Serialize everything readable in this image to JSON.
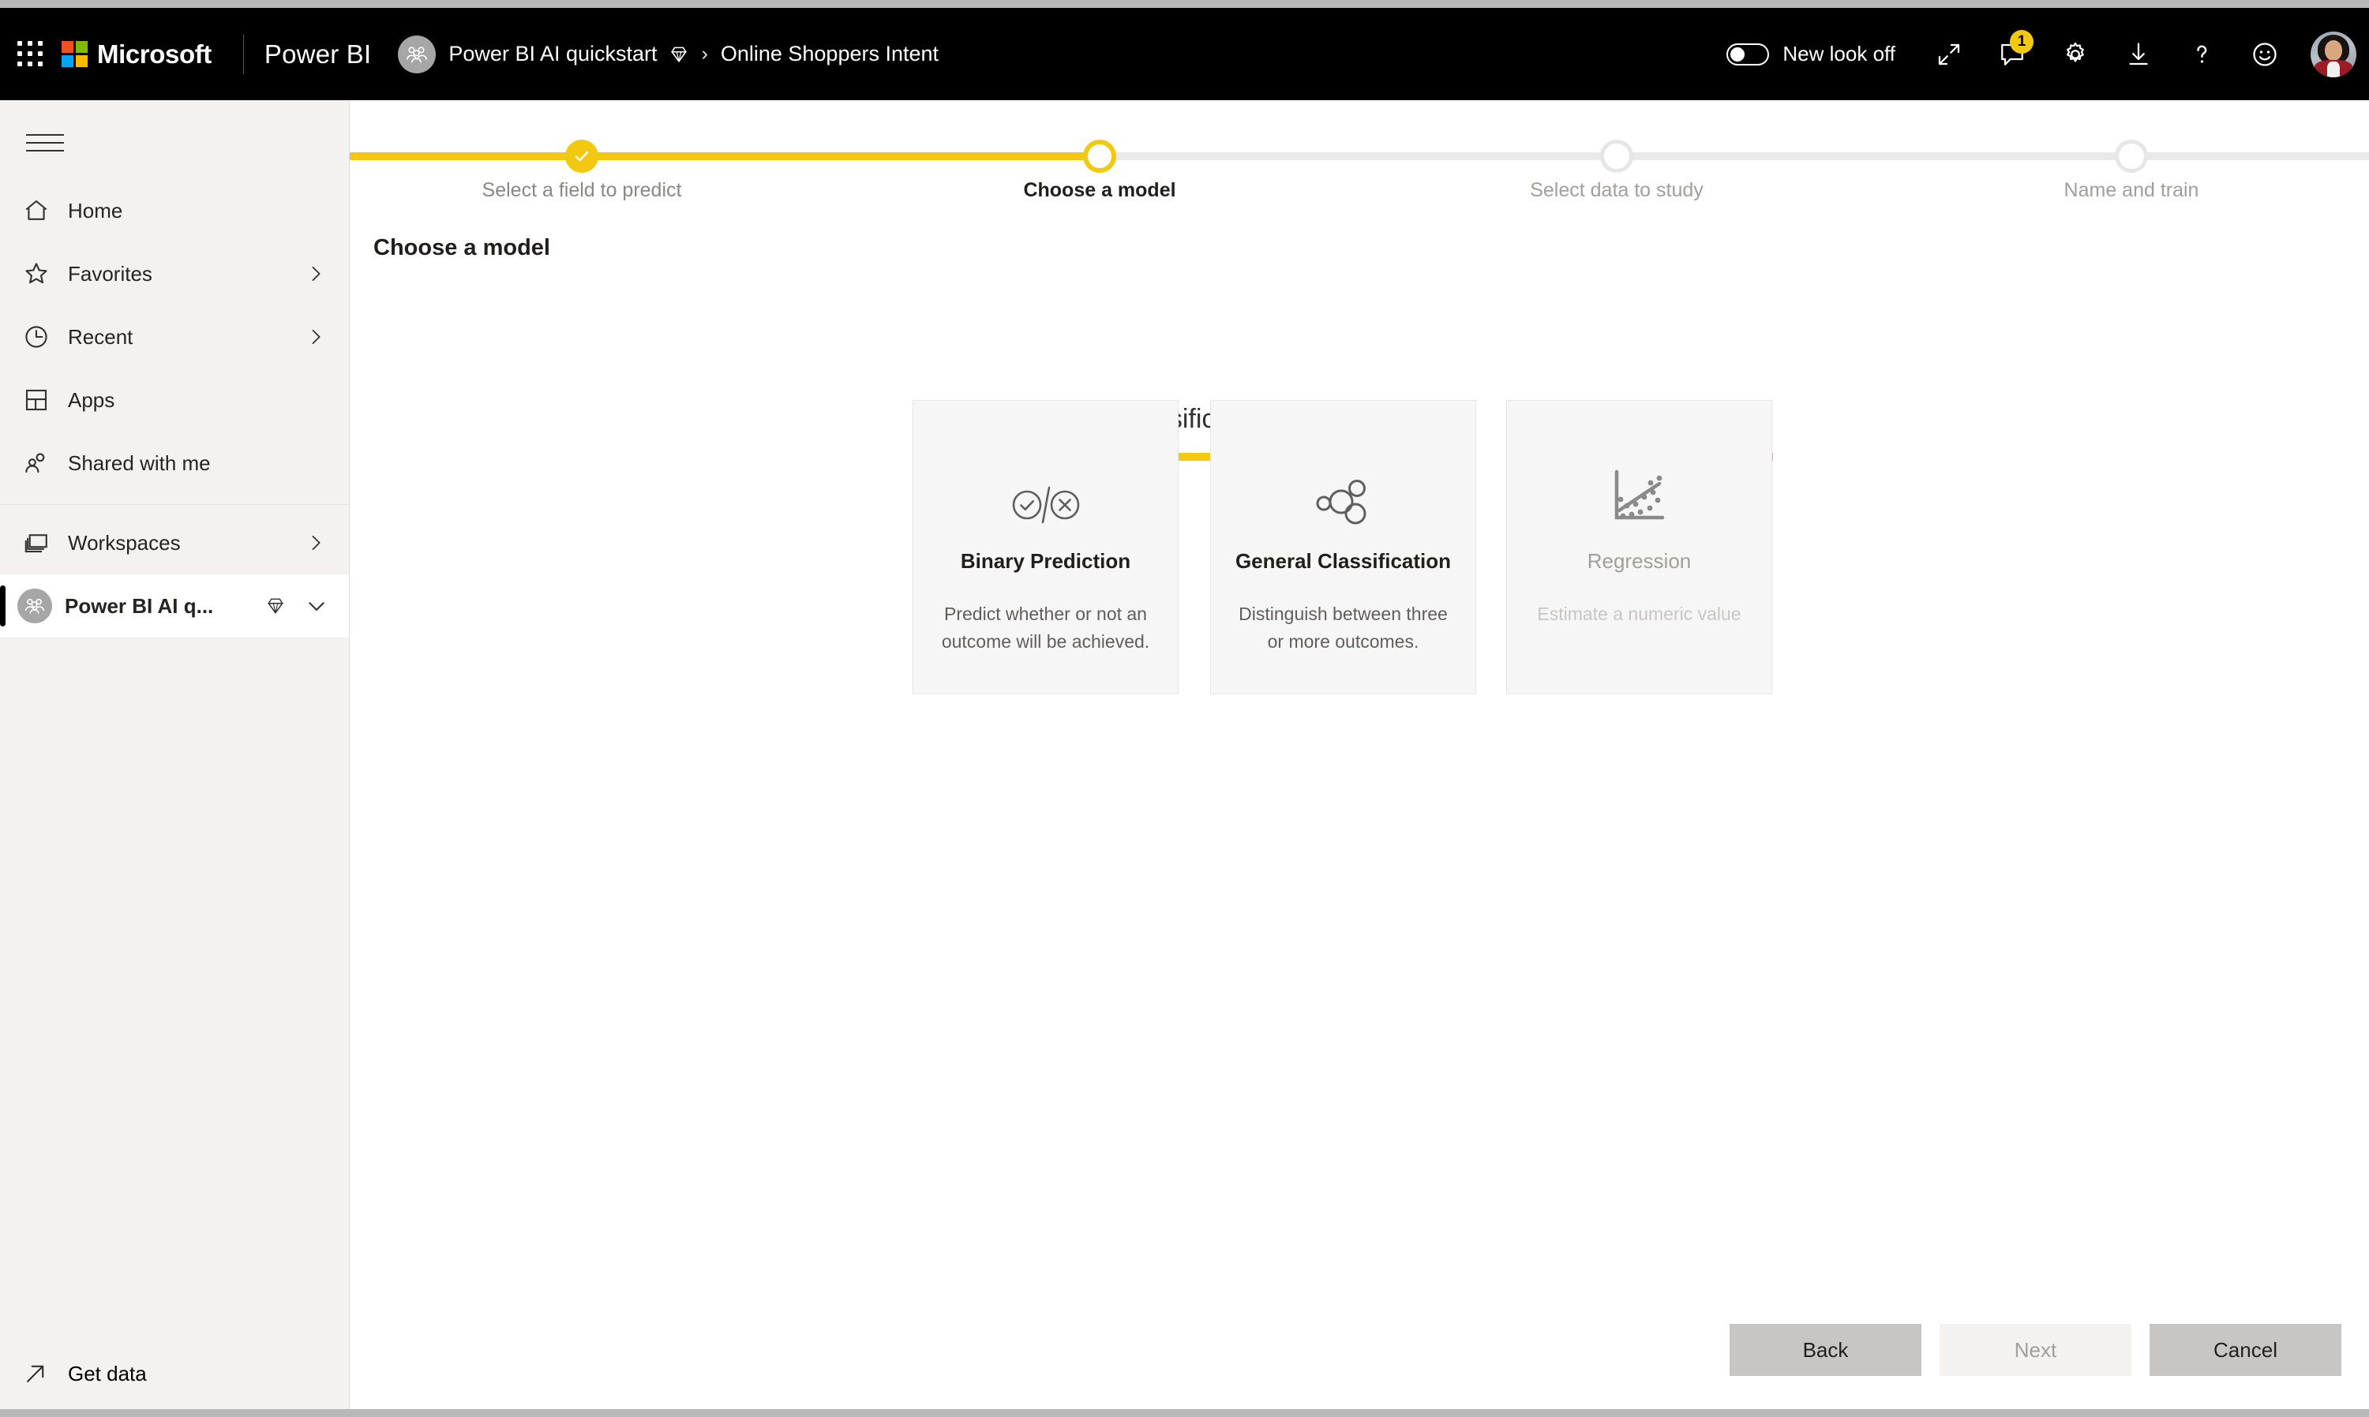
{
  "topbar": {
    "waffle_icon": "app-launcher-icon",
    "brand": "Microsoft",
    "product": "Power BI",
    "workspace_avatar_icon": "group-avatar-icon",
    "breadcrumb": {
      "workspace": "Power BI AI quickstart",
      "premium_icon": "premium-diamond-icon",
      "separator": "›",
      "item": "Online Shoppers Intent"
    },
    "new_look_toggle": {
      "label": "New look off",
      "state": "off"
    },
    "actions": [
      {
        "name": "expand-icon",
        "glyph": "expand"
      },
      {
        "name": "feedback-comment-icon",
        "glyph": "comment",
        "badge": "1"
      },
      {
        "name": "settings-gear-icon",
        "glyph": "gear"
      },
      {
        "name": "download-icon",
        "glyph": "download"
      },
      {
        "name": "help-icon",
        "glyph": "question"
      },
      {
        "name": "smiley-feedback-icon",
        "glyph": "smiley"
      }
    ],
    "account_avatar": "user-avatar"
  },
  "sidebar": {
    "hamburger_icon": "hamburger-menu-icon",
    "items": [
      {
        "label": "Home",
        "icon": "home-icon",
        "chevron": false
      },
      {
        "label": "Favorites",
        "icon": "star-icon",
        "chevron": true
      },
      {
        "label": "Recent",
        "icon": "clock-icon",
        "chevron": true
      },
      {
        "label": "Apps",
        "icon": "apps-grid-icon",
        "chevron": false
      },
      {
        "label": "Shared with me",
        "icon": "people-shared-icon",
        "chevron": false
      }
    ],
    "workspaces": {
      "label": "Workspaces",
      "icon": "workspaces-stack-icon",
      "chevron": true
    },
    "current_workspace": {
      "label": "Power BI AI q...",
      "avatar_icon": "workspace-avatar-icon",
      "premium_icon": "premium-diamond-icon",
      "chevron_icon": "chevron-down-icon"
    },
    "get_data": {
      "label": "Get data",
      "icon": "get-data-arrow-icon"
    }
  },
  "wizard": {
    "steps": [
      {
        "label": "Select a field to predict",
        "state": "done"
      },
      {
        "label": "Choose a model",
        "state": "current"
      },
      {
        "label": "Select data to study",
        "state": "todo"
      },
      {
        "label": "Name and train",
        "state": "todo"
      }
    ],
    "page_title": "Choose a model",
    "sections": [
      {
        "name": "classification",
        "title": "Classification"
      },
      {
        "name": "regression",
        "title": "Regression"
      }
    ],
    "cards": [
      {
        "name": "binary-prediction",
        "title": "Binary Prediction",
        "description": "Predict whether or not an outcome will be achieved.",
        "icon": "check-slash-cross-icon",
        "disabled": false
      },
      {
        "name": "general-classification",
        "title": "General Classification",
        "description": "Distinguish between three or more outcomes.",
        "icon": "bubbles-cluster-icon",
        "disabled": false
      },
      {
        "name": "regression",
        "title": "Regression",
        "description": "Estimate a numeric value",
        "icon": "scatter-trendline-icon",
        "disabled": true
      }
    ],
    "footer": {
      "back": "Back",
      "next": "Next",
      "cancel": "Cancel"
    }
  },
  "colors": {
    "accent_yellow": "#f2c811",
    "topbar_black": "#000000",
    "sidebar_gray": "#f3f2f1",
    "card_gray": "#f6f6f6",
    "button_gray": "#c8c6c4"
  }
}
